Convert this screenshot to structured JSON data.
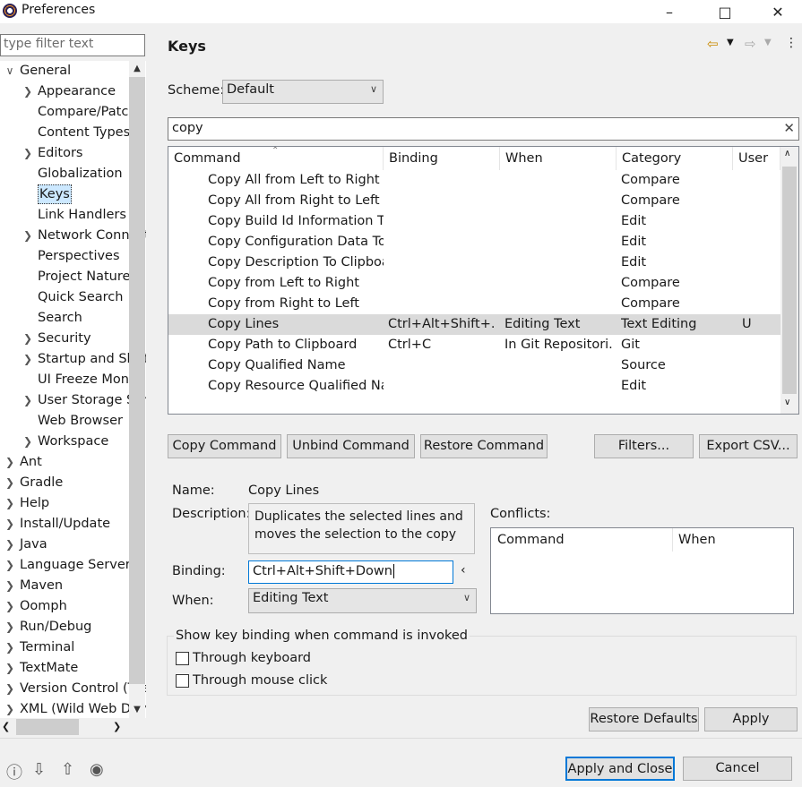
{
  "window": {
    "title": "Preferences"
  },
  "filter": {
    "placeholder": "type filter text"
  },
  "tree": [
    {
      "label": "General",
      "expand": "v",
      "indent": 0
    },
    {
      "label": "Appearance",
      "expand": ">",
      "indent": 1
    },
    {
      "label": "Compare/Patch",
      "expand": "",
      "indent": 1
    },
    {
      "label": "Content Types",
      "expand": "",
      "indent": 1
    },
    {
      "label": "Editors",
      "expand": ">",
      "indent": 1
    },
    {
      "label": "Globalization",
      "expand": "",
      "indent": 1
    },
    {
      "label": "Keys",
      "expand": "",
      "indent": 1,
      "selected": true
    },
    {
      "label": "Link Handlers",
      "expand": "",
      "indent": 1
    },
    {
      "label": "Network Connections",
      "expand": ">",
      "indent": 1
    },
    {
      "label": "Perspectives",
      "expand": "",
      "indent": 1
    },
    {
      "label": "Project Natures",
      "expand": "",
      "indent": 1
    },
    {
      "label": "Quick Search",
      "expand": "",
      "indent": 1
    },
    {
      "label": "Search",
      "expand": "",
      "indent": 1
    },
    {
      "label": "Security",
      "expand": ">",
      "indent": 1
    },
    {
      "label": "Startup and Shutdown",
      "expand": ">",
      "indent": 1
    },
    {
      "label": "UI Freeze Monitoring",
      "expand": "",
      "indent": 1
    },
    {
      "label": "User Storage Service",
      "expand": ">",
      "indent": 1
    },
    {
      "label": "Web Browser",
      "expand": "",
      "indent": 1
    },
    {
      "label": "Workspace",
      "expand": ">",
      "indent": 1
    },
    {
      "label": "Ant",
      "expand": ">",
      "indent": 0
    },
    {
      "label": "Gradle",
      "expand": ">",
      "indent": 0
    },
    {
      "label": "Help",
      "expand": ">",
      "indent": 0
    },
    {
      "label": "Install/Update",
      "expand": ">",
      "indent": 0
    },
    {
      "label": "Java",
      "expand": ">",
      "indent": 0
    },
    {
      "label": "Language Servers",
      "expand": ">",
      "indent": 0
    },
    {
      "label": "Maven",
      "expand": ">",
      "indent": 0
    },
    {
      "label": "Oomph",
      "expand": ">",
      "indent": 0
    },
    {
      "label": "Run/Debug",
      "expand": ">",
      "indent": 0
    },
    {
      "label": "Terminal",
      "expand": ">",
      "indent": 0
    },
    {
      "label": "TextMate",
      "expand": ">",
      "indent": 0
    },
    {
      "label": "Version Control (Team)",
      "expand": ">",
      "indent": 0
    },
    {
      "label": "XML (Wild Web Developer)",
      "expand": ">",
      "indent": 0
    }
  ],
  "page": {
    "title": "Keys",
    "scheme_label": "Scheme:",
    "scheme_value": "Default",
    "search_value": "copy",
    "columns": [
      "Command",
      "Binding",
      "When",
      "Category",
      "User"
    ],
    "rows": [
      {
        "command": "Copy All from Left to Right",
        "binding": "",
        "when": "",
        "category": "Compare",
        "user": ""
      },
      {
        "command": "Copy All from Right to Left",
        "binding": "",
        "when": "",
        "category": "Compare",
        "user": ""
      },
      {
        "command": "Copy Build Id Information To Clipboard",
        "binding": "",
        "when": "",
        "category": "Edit",
        "user": ""
      },
      {
        "command": "Copy Configuration Data To Clipboard",
        "binding": "",
        "when": "",
        "category": "Edit",
        "user": ""
      },
      {
        "command": "Copy Description To Clipboard",
        "binding": "",
        "when": "",
        "category": "Edit",
        "user": ""
      },
      {
        "command": "Copy from Left to Right",
        "binding": "",
        "when": "",
        "category": "Compare",
        "user": ""
      },
      {
        "command": "Copy from Right to Left",
        "binding": "",
        "when": "",
        "category": "Compare",
        "user": ""
      },
      {
        "command": "Copy Lines",
        "binding": "Ctrl+Alt+Shift+...",
        "when": "Editing Text",
        "category": "Text Editing",
        "user": "U",
        "selected": true
      },
      {
        "command": "Copy Path to Clipboard",
        "binding": "Ctrl+C",
        "when": "In Git Repositori...",
        "category": "Git",
        "user": ""
      },
      {
        "command": "Copy Qualified Name",
        "binding": "",
        "when": "",
        "category": "Source",
        "user": ""
      },
      {
        "command": "Copy Resource Qualified Name",
        "binding": "",
        "when": "",
        "category": "Edit",
        "user": ""
      }
    ],
    "buttons": {
      "copy_command": "Copy Command",
      "unbind_command": "Unbind Command",
      "restore_command": "Restore Command",
      "filters": "Filters...",
      "export_csv": "Export CSV..."
    },
    "details": {
      "name_label": "Name:",
      "name_value": "Copy Lines",
      "description_label": "Description:",
      "description_value": "Duplicates the selected lines and moves the selection to the copy",
      "binding_label": "Binding:",
      "binding_value": "Ctrl+Alt+Shift+Down",
      "when_label": "When:",
      "when_value": "Editing Text",
      "conflicts_label": "Conflicts:",
      "conflicts_columns": [
        "Command",
        "When"
      ]
    },
    "show_binding": {
      "legend": "Show key binding when command is invoked",
      "through_keyboard": "Through keyboard",
      "through_mouse": "Through mouse click"
    },
    "restore_defaults": "Restore Defaults",
    "apply": "Apply"
  },
  "footer": {
    "apply_close": "Apply and Close",
    "cancel": "Cancel"
  },
  "colors": {
    "selection": "#dadada",
    "accent": "#0078d7"
  }
}
